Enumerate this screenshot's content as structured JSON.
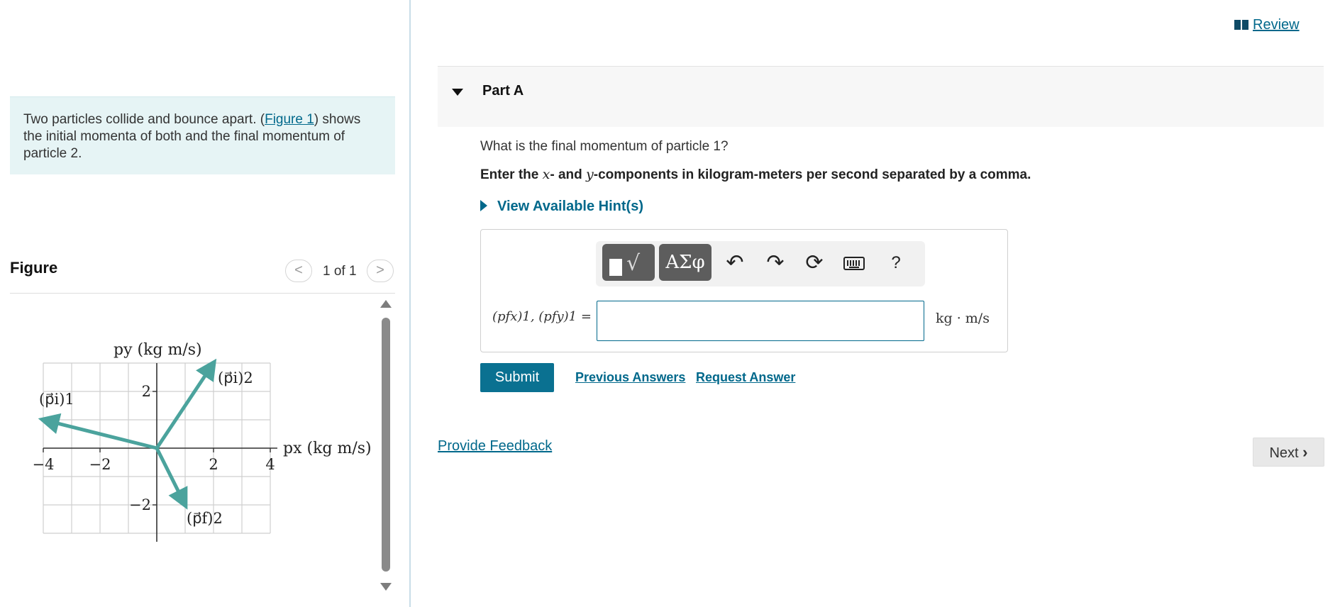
{
  "intro": {
    "text_before": "Two particles collide and bounce apart. (",
    "figure_link": "Figure 1",
    "text_after": ") shows the initial momenta of both and the final momentum of particle 2."
  },
  "figure": {
    "heading": "Figure",
    "counter": "1 of 1",
    "prev_icon": "<",
    "next_icon": ">"
  },
  "chart_data": {
    "type": "vector diagram",
    "xlabel": "px (kg m/s)",
    "ylabel": "py (kg m/s)",
    "xlim": [
      -4,
      4
    ],
    "ylim": [
      -3,
      3
    ],
    "x_tick_labels": [
      "−4",
      "−2",
      "2",
      "4"
    ],
    "y_tick_labels": [
      "2",
      "−2"
    ],
    "grid": true,
    "vectors": [
      {
        "name": "(p⃗i)1",
        "x": -4,
        "y": 1
      },
      {
        "name": "(p⃗i)2",
        "x": 2,
        "y": 3
      },
      {
        "name": "(p⃗f)2",
        "x": 1,
        "y": -2
      }
    ]
  },
  "review": {
    "label": "Review",
    "icon": "book-icon"
  },
  "part_a": {
    "title": "Part A",
    "question": "What is the final momentum of particle 1?",
    "instruction_pre": "Enter the ",
    "var_x": "x",
    "instruction_mid": "- and ",
    "var_y": "y",
    "instruction_post": "-components in kilogram-meters per second separated by a comma.",
    "hint_label": "View Available Hint(s)"
  },
  "answer": {
    "label": "(pfx)1, (pfy)1 =",
    "value": "",
    "unit": "kg · m/s"
  },
  "toolbar": {
    "template_icon": "√",
    "symbols_label": "ΑΣφ",
    "undo_icon": "↶",
    "redo_icon": "↷",
    "reset_icon": "⟳",
    "help_label": "?"
  },
  "actions": {
    "submit": "Submit",
    "previous_answers": "Previous Answers",
    "request_answer": "Request Answer",
    "provide_feedback": "Provide Feedback",
    "next": "Next"
  },
  "colors": {
    "accent": "#00688b",
    "vector": "#4ba39d",
    "intro_bg": "#e6f4f5"
  }
}
